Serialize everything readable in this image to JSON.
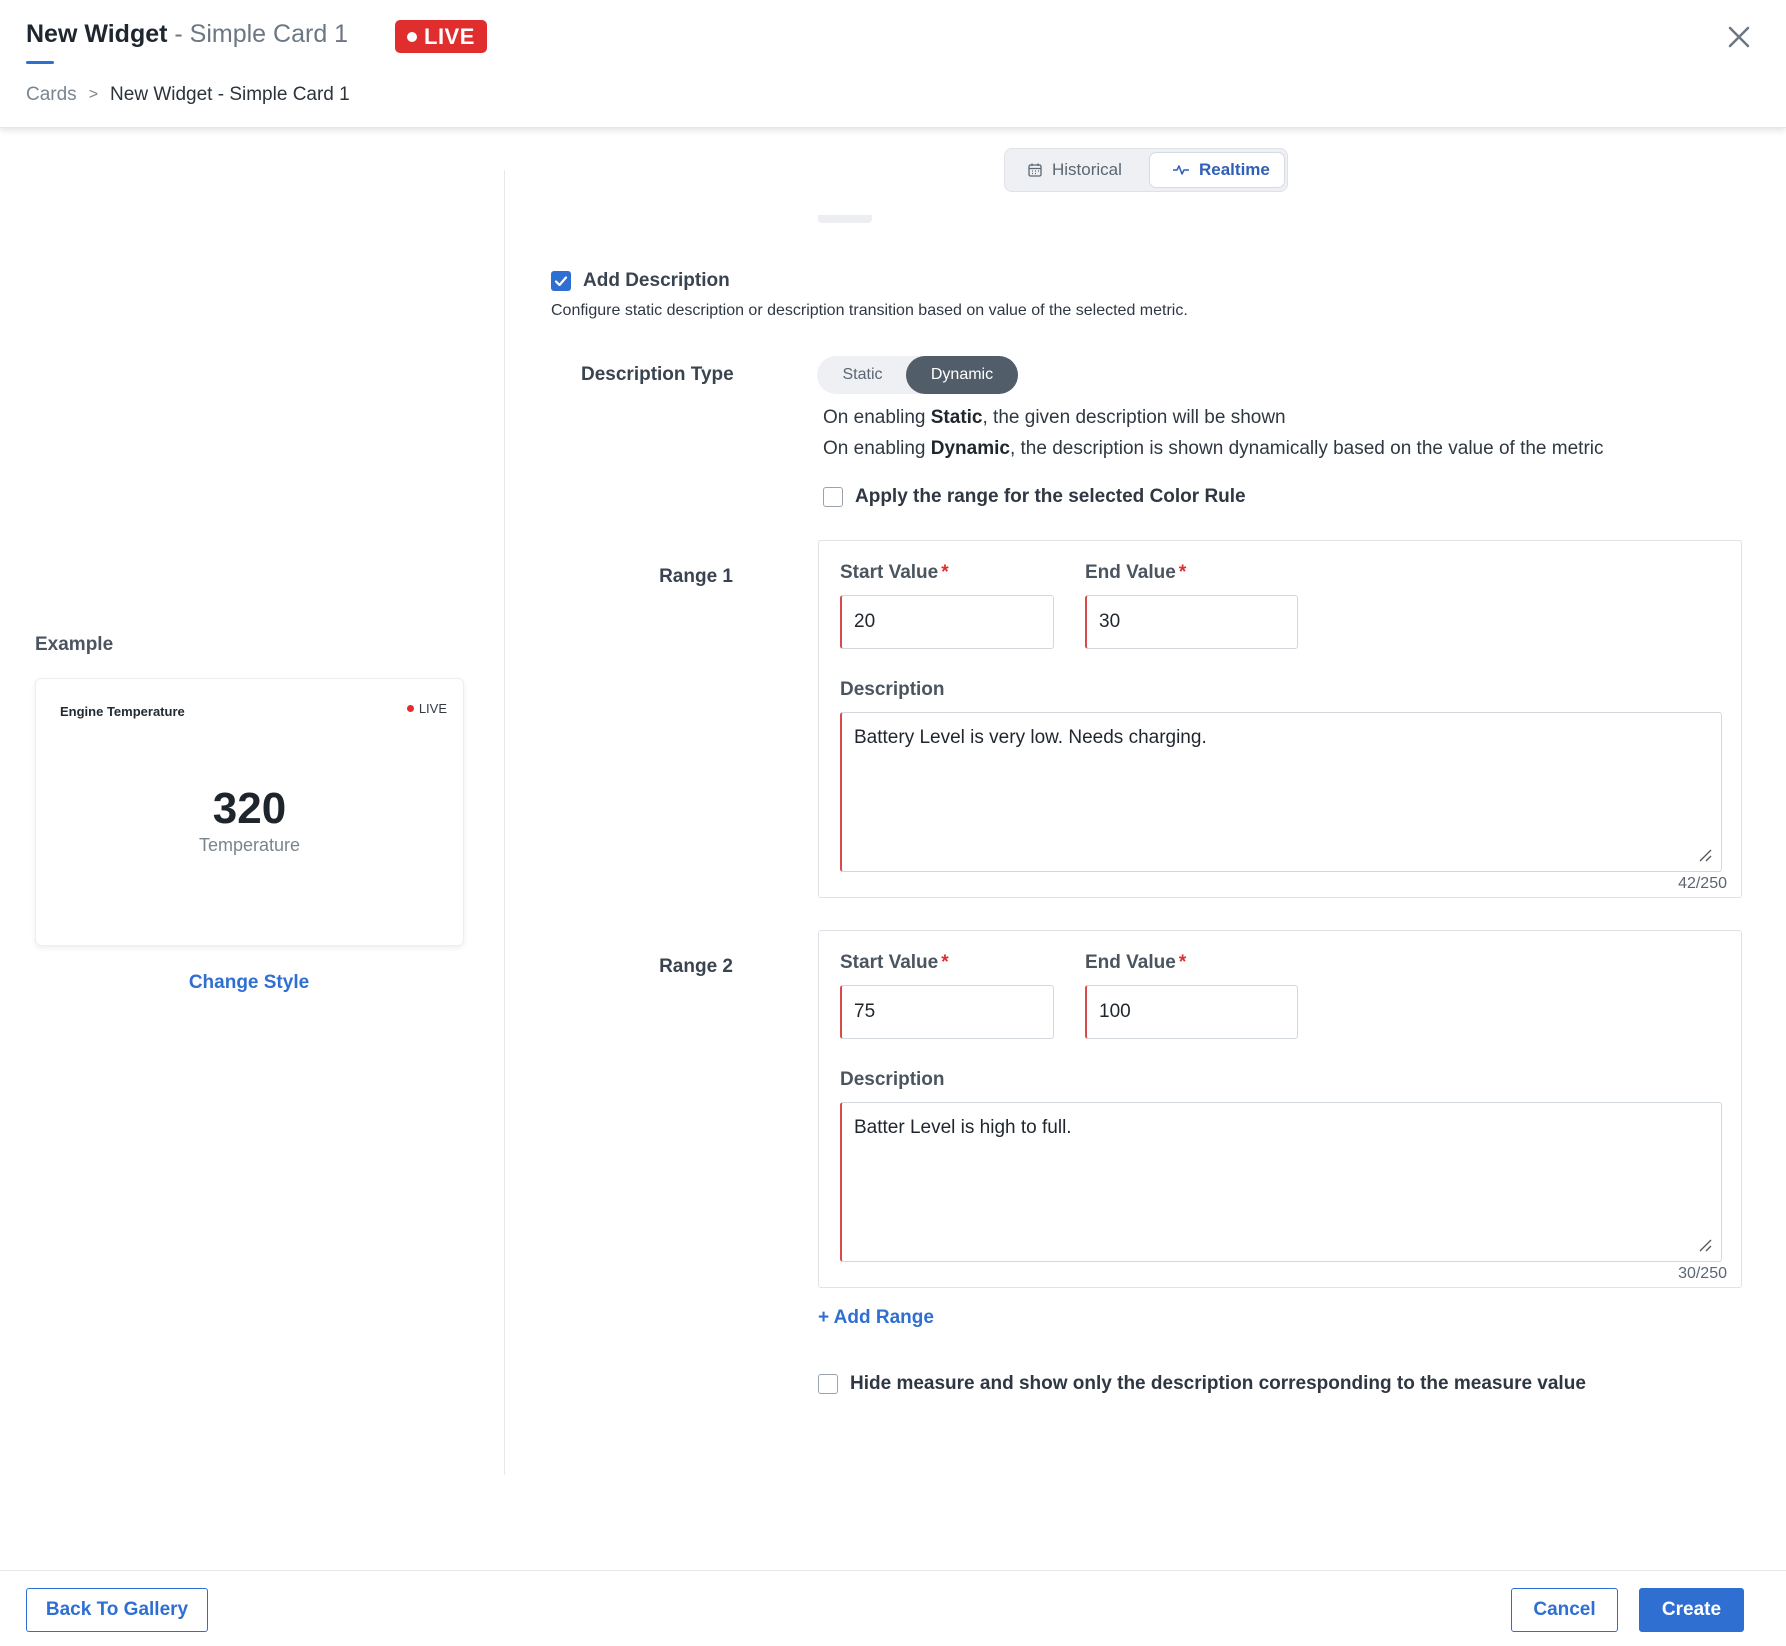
{
  "header": {
    "title_main": "New Widget",
    "title_sep": " - ",
    "title_sub": "Simple Card 1",
    "live_badge": "LIVE",
    "breadcrumb": {
      "root": "Cards",
      "separator": ">",
      "current": "New Widget - Simple Card 1"
    }
  },
  "preview": {
    "example_label": "Example",
    "card": {
      "title": "Engine Temperature",
      "live": "LIVE",
      "value": "320",
      "unit": "Temperature"
    },
    "change_style": "Change Style"
  },
  "mode_toggle": {
    "historical": "Historical",
    "realtime": "Realtime",
    "selected": "Realtime"
  },
  "description": {
    "add_label": "Add Description",
    "add_checked": true,
    "help": "Configure static description or description transition based on value of the selected metric.",
    "type_label": "Description Type",
    "type_options": [
      "Static",
      "Dynamic"
    ],
    "type_selected": "Dynamic",
    "info_static_pre": "On enabling ",
    "info_static_bold": "Static",
    "info_static_post": ", the given description will be shown",
    "info_dynamic_pre": "On enabling ",
    "info_dynamic_bold": "Dynamic",
    "info_dynamic_post": ", the description is shown dynamically based on the value of the metric",
    "apply_color_rule_label": "Apply the range for the selected Color Rule",
    "apply_color_rule_checked": false
  },
  "ranges": [
    {
      "label": "Range 1",
      "start_label": "Start Value",
      "end_label": "End Value",
      "required_mark": "*",
      "start_value": "20",
      "end_value": "30",
      "description_label": "Description",
      "description": "Battery Level is very low. Needs charging.",
      "counter": "42/250"
    },
    {
      "label": "Range 2",
      "start_label": "Start Value",
      "end_label": "End Value",
      "required_mark": "*",
      "start_value": "75",
      "end_value": "100",
      "description_label": "Description",
      "description": "Batter Level is high to full.",
      "counter": "30/250"
    }
  ],
  "add_range": "+ Add Range",
  "hide_measure": {
    "label": "Hide measure and show only the description corresponding to the measure value",
    "checked": false
  },
  "footer": {
    "back": "Back To Gallery",
    "cancel": "Cancel",
    "create": "Create"
  },
  "colors": {
    "accent": "#2f6fd1",
    "live": "#e02e2e",
    "segment_selected": "#525d6a"
  }
}
